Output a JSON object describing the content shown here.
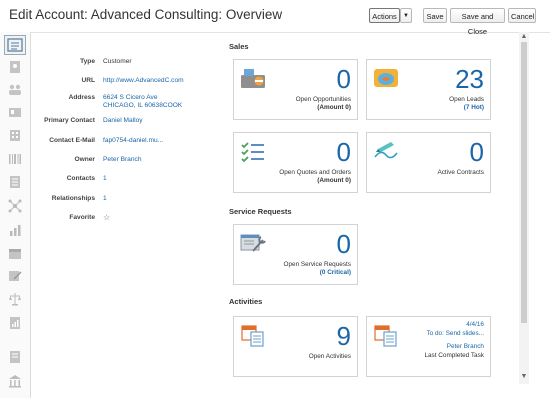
{
  "page": {
    "title": "Edit Account: Advanced Consulting: Overview"
  },
  "toolbar": {
    "actions_label": "Actions",
    "actions_arrow": "▼",
    "save_label": "Save",
    "save_close_label": "Save and Close",
    "cancel_label": "Cancel"
  },
  "sidebar": {
    "icons": [
      "overview-icon",
      "contact-card-icon",
      "people-icon",
      "id-card-icon",
      "building-icon",
      "barcode-icon",
      "list-icon",
      "network-icon",
      "bar-chart-icon",
      "calendar-icon",
      "edit-form-icon",
      "scales-icon",
      "chart-doc-icon",
      "document-icon",
      "institution-icon"
    ]
  },
  "details": {
    "type_label": "Type",
    "type_value": "Customer",
    "url_label": "URL",
    "url_value": "http://www.AdvancedC.com",
    "address_label": "Address",
    "address_line1": "6624 S Cicero Ave",
    "address_line2": "CHICAGO, IL 60638COOK",
    "primary_contact_label": "Primary Contact",
    "primary_contact_value": "Daniel Malloy",
    "contact_email_label": "Contact E-Mail",
    "contact_email_value": "fap0754-daniel.mu...",
    "owner_label": "Owner",
    "owner_value": "Peter Branch",
    "contacts_label": "Contacts",
    "contacts_value": "1",
    "relationships_label": "Relationships",
    "relationships_value": "1",
    "favorite_label": "Favorite",
    "favorite_icon": "☆"
  },
  "sales": {
    "title": "Sales",
    "opportunities": {
      "count": "0",
      "caption": "Open Opportunities",
      "sub": "(Amount 0)",
      "icon": "opportunity-register-icon"
    },
    "leads": {
      "count": "23",
      "caption": "Open Leads",
      "sub": "(7 Hot)",
      "icon": "fishbowl-icon"
    },
    "quotes": {
      "count": "0",
      "caption": "Open Quotes and Orders",
      "sub": "(Amount 0)",
      "icon": "checklist-icon"
    },
    "contracts": {
      "count": "0",
      "caption": "Active Contracts",
      "icon": "contract-pen-icon"
    }
  },
  "service": {
    "title": "Service Requests",
    "requests": {
      "count": "0",
      "caption": "Open Service Requests",
      "sub": "(0 Critical)",
      "icon": "service-wrench-icon"
    }
  },
  "activities": {
    "title": "Activities",
    "open": {
      "count": "9",
      "caption": "Open Activities",
      "icon": "calendar-doc-icon"
    },
    "task": {
      "date": "4/4/16",
      "title": "To do: Send slides...",
      "owner": "Peter Branch",
      "caption": "Last Completed Task",
      "icon": "calendar-doc-icon"
    }
  },
  "colors": {
    "accent": "#1a66a8",
    "border": "#d3d3d3"
  }
}
